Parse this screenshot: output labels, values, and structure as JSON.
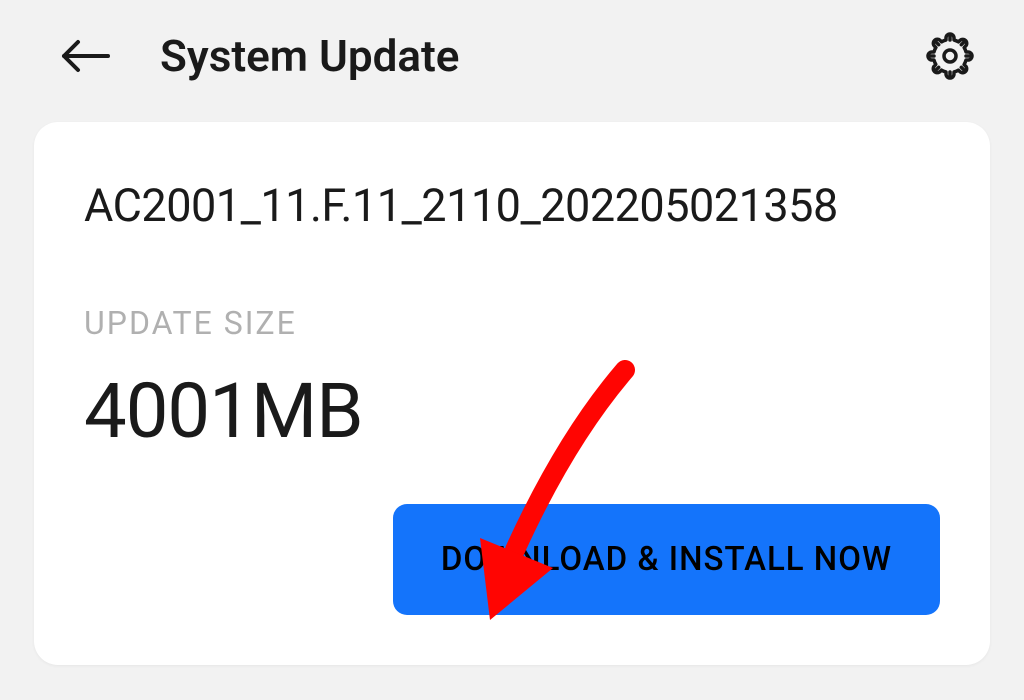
{
  "header": {
    "title": "System Update"
  },
  "update": {
    "version": "AC2001_11.F.11_2110_202205021358",
    "size_label": "UPDATE SIZE",
    "size_value": "4001MB",
    "download_button": "DOWNLOAD & INSTALL NOW"
  },
  "colors": {
    "primary": "#1474fb",
    "arrow": "#ff0502"
  }
}
